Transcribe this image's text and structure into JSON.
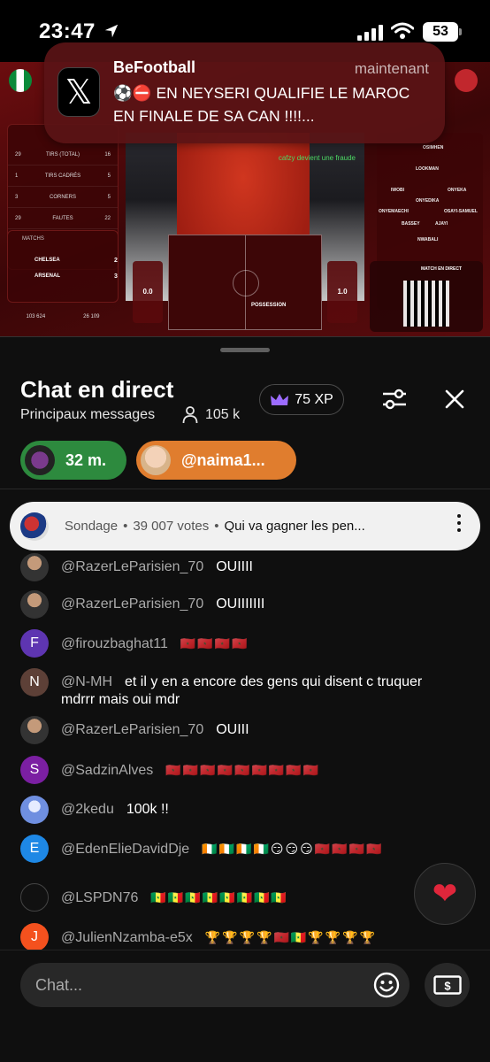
{
  "status_bar": {
    "time": "23:47",
    "battery": "53"
  },
  "notification": {
    "app": "BeFootball",
    "time": "maintenant",
    "body": "⚽️⛔️ EN NEYSERI QUALIFIE LE MAROC EN FINALE DE SA CAN !!!!...",
    "app_icon_glyph": "𝕏"
  },
  "video": {
    "stats_rows": [
      [
        "29",
        "TIRS (TOTAL)",
        "16"
      ],
      [
        "1",
        "TIRS CADRÉS",
        "5"
      ],
      [
        "3",
        "CORNERS",
        "5"
      ],
      [
        "29",
        "FAUTES",
        "22"
      ]
    ],
    "match_label": "MATCHS",
    "teams": [
      {
        "name": "CHELSEA",
        "score": "2"
      },
      {
        "name": "ARSENAL",
        "score": "3"
      }
    ],
    "footer_left": "103 624",
    "footer_right": "26 109",
    "cam_overlay": "cafzy devient une fraude",
    "poss_left": "0.0",
    "poss_right": "1.0",
    "possession_label": "POSSESSION",
    "qr_label": "MATCH EN DIRECT",
    "lineup": [
      "OSIMHEN",
      "LOOKMAN",
      "IWOBI",
      "ONYEKA",
      "ONYEDIKA",
      "ONYEMAECHI",
      "OSAYI-SAMUEL",
      "BASSEY",
      "AJAYI",
      "NWABALI"
    ]
  },
  "chat": {
    "title": "Chat en direct",
    "subtitle": "Principaux messages",
    "viewers": "105 k",
    "xp": "75 XP",
    "pinned": [
      {
        "label": "32 m.",
        "color": "#2d8a3e"
      },
      {
        "label": "@naima1...",
        "color": "#e07d2e"
      }
    ],
    "poll": {
      "label": "Sondage",
      "votes": "39 007 votes",
      "question": "Qui va gagner les pen..."
    },
    "messages": [
      {
        "user": "@RazerLeParisien_70",
        "text": "OUIIII",
        "avatar": "",
        "avatar_color": "#3a3a3a"
      },
      {
        "user": "@RazerLeParisien_70",
        "text": "OUIIIIIII",
        "avatar": "",
        "avatar_color": "#3a3a3a"
      },
      {
        "user": "@firouzbaghat11",
        "text": "🇲🇦🇲🇦🇲🇦🇲🇦",
        "avatar": "F",
        "avatar_color": "#5e35b1"
      },
      {
        "user": "@N-MH",
        "text": "et il y en a encore des gens qui disent c truquer mdrrr mais oui mdr",
        "avatar": "N",
        "avatar_color": "#5d4037"
      },
      {
        "user": "@RazerLeParisien_70",
        "text": "OUIII",
        "avatar": "",
        "avatar_color": "#3a3a3a"
      },
      {
        "user": "@SadzinAlves",
        "text": "🇲🇦🇲🇦🇲🇦🇲🇦🇲🇦🇲🇦🇲🇦🇲🇦🇲🇦",
        "avatar": "S",
        "avatar_color": "#7b1fa2"
      },
      {
        "user": "@2kedu",
        "text": "100k !!",
        "avatar": "",
        "avatar_color": "#6f8fe0"
      },
      {
        "user": "@EdenElieDavidDje",
        "text": "🇨🇮🇨🇮🇨🇮🇨🇮😏😏😏🇲🇦🇲🇦🇲🇦🇲🇦",
        "avatar": "E",
        "avatar_color": "#1e88e5"
      },
      {
        "user": "@LSPDN76",
        "text": "🇸🇳🇸🇳🇸🇳🇸🇳🇸🇳🇸🇳🇸🇳🇸🇳",
        "avatar": "",
        "avatar_color": "#111"
      },
      {
        "user": "@JulienNzamba-e5x",
        "text": "🏆🏆🏆🏆🇲🇦🇸🇳🏆🏆🏆🏆",
        "avatar": "J",
        "avatar_color": "#f4511e"
      }
    ],
    "input_placeholder": "Chat..."
  },
  "colors": {
    "background": "#0f0f0f",
    "accent_red": "#e0263b",
    "username": "#aaaaaa"
  },
  "icons": [
    "location-arrow-icon",
    "signal-icon",
    "wifi-icon",
    "battery-icon",
    "x-app-icon",
    "person-icon",
    "crown-icon",
    "sliders-icon",
    "close-icon",
    "more-vertical-icon",
    "heart-icon",
    "emoji-icon",
    "money-icon"
  ]
}
